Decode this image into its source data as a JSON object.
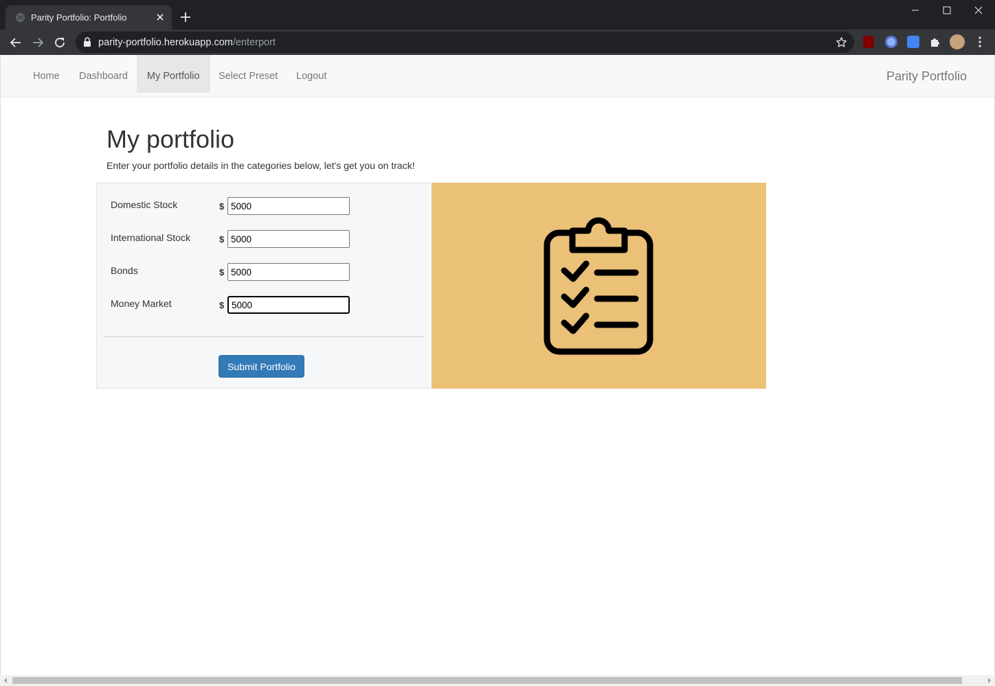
{
  "browser": {
    "tab_title": "Parity Portfolio: Portfolio",
    "url_host": "parity-portfolio.herokuapp.com",
    "url_path": "/enterport"
  },
  "nav": {
    "items": [
      {
        "label": "Home"
      },
      {
        "label": "Dashboard"
      },
      {
        "label": "My Portfolio"
      },
      {
        "label": "Select Preset"
      },
      {
        "label": "Logout"
      }
    ],
    "active": "My Portfolio",
    "brand": "Parity Portfolio"
  },
  "main": {
    "title": "My portfolio",
    "subtitle": "Enter your portfolio details in the categories below, let's get you on track!",
    "currency_symbol": "$",
    "fields": [
      {
        "label": "Domestic Stock",
        "value": "5000"
      },
      {
        "label": "International Stock",
        "value": "5000"
      },
      {
        "label": "Bonds",
        "value": "5000"
      },
      {
        "label": "Money Market",
        "value": "5000"
      }
    ],
    "submit_label": "Submit Portfolio",
    "image_icon": "clipboard-checklist-icon"
  },
  "colors": {
    "accent": "#337ab7",
    "image_bg": "#ebc178",
    "chrome_dark": "#202124"
  }
}
